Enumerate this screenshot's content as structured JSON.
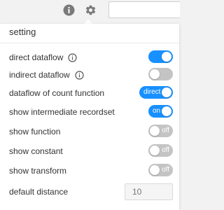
{
  "toolbar": {
    "search_value": ""
  },
  "settings": {
    "title": "setting",
    "rows": [
      {
        "label": "direct dataflow",
        "state": "on",
        "switch_text": ""
      },
      {
        "label": "indirect dataflow",
        "state": "off",
        "switch_text": ""
      },
      {
        "label": "dataflow of count function",
        "state": "on",
        "switch_text": "direct"
      },
      {
        "label": "show intermediate recordset",
        "state": "on",
        "switch_text": "on"
      },
      {
        "label": "show function",
        "state": "off",
        "switch_text": "off"
      },
      {
        "label": "show constant",
        "state": "off",
        "switch_text": "off"
      },
      {
        "label": "show transform",
        "state": "off",
        "switch_text": "off"
      }
    ],
    "default_distance": {
      "label": "default distance",
      "placeholder": "10"
    }
  },
  "icons": {
    "top": [
      "info-circle-icon",
      "gear-icon"
    ],
    "row_info": "info-circle-outline-icon"
  },
  "colors": {
    "accent": "#1890ff",
    "switch_off": "#c4c4c4",
    "icon_gray": "#7a7a7a"
  }
}
